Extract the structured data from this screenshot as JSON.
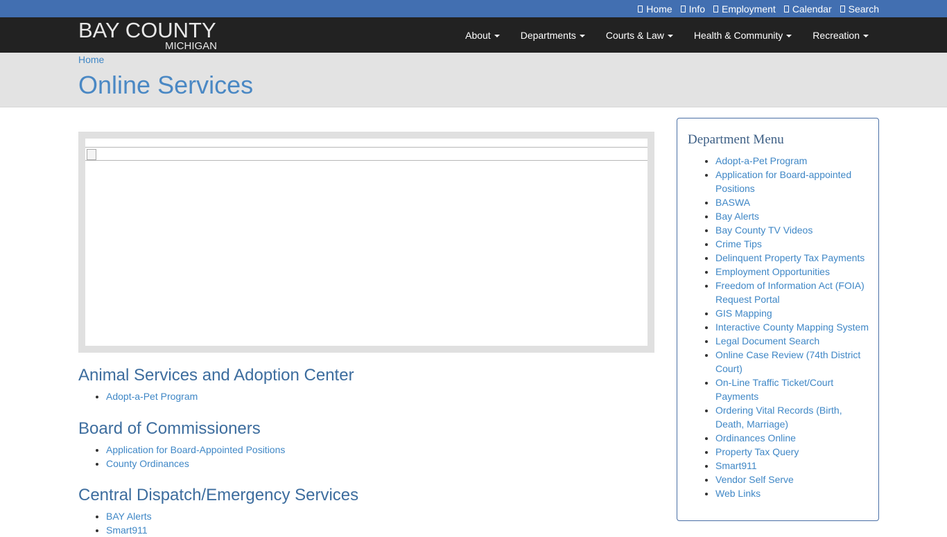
{
  "utility_links": [
    {
      "label": "Home",
      "icon": "home-icon"
    },
    {
      "label": "Info",
      "icon": "info-icon"
    },
    {
      "label": "Employment",
      "icon": "briefcase-icon"
    },
    {
      "label": "Calendar",
      "icon": "calendar-icon"
    },
    {
      "label": "Search",
      "icon": "search-icon"
    }
  ],
  "logo": {
    "line1": "BAY COUNTY",
    "line2": "MICHIGAN"
  },
  "nav": [
    {
      "label": "About"
    },
    {
      "label": "Departments"
    },
    {
      "label": "Courts & Law"
    },
    {
      "label": "Health & Community"
    },
    {
      "label": "Recreation"
    }
  ],
  "breadcrumb": {
    "home": "Home"
  },
  "page_title": "Online Services",
  "sections": [
    {
      "heading": "Animal Services and Adoption Center",
      "links": [
        "Adopt-a-Pet Program"
      ]
    },
    {
      "heading": "Board of Commissioners",
      "links": [
        "Application for Board-Appointed Positions",
        "County Ordinances"
      ]
    },
    {
      "heading": "Central Dispatch/Emergency Services",
      "links": [
        "BAY Alerts",
        "Smart911"
      ]
    }
  ],
  "sidebar": {
    "title": "Department Menu",
    "items": [
      "Adopt-a-Pet Program",
      "Application for Board-appointed Positions",
      "BASWA",
      "Bay Alerts",
      "Bay County TV Videos",
      "Crime Tips",
      "Delinquent Property Tax Payments",
      "Employment Opportunities",
      "Freedom of Information Act (FOIA) Request Portal",
      "GIS Mapping",
      "Interactive County Mapping System",
      "Legal Document Search",
      "Online Case Review (74th District Court)",
      "On-Line Traffic Ticket/Court Payments",
      "Ordering Vital Records (Birth, Death, Marriage)",
      "Ordinances Online",
      "Property Tax Query",
      "Smart911",
      "Vendor Self Serve",
      "Web Links"
    ]
  },
  "colors": {
    "utility_bar": "#426fb1",
    "navbar": "#222222",
    "link": "#3f87c6",
    "title": "#4a88c4"
  }
}
